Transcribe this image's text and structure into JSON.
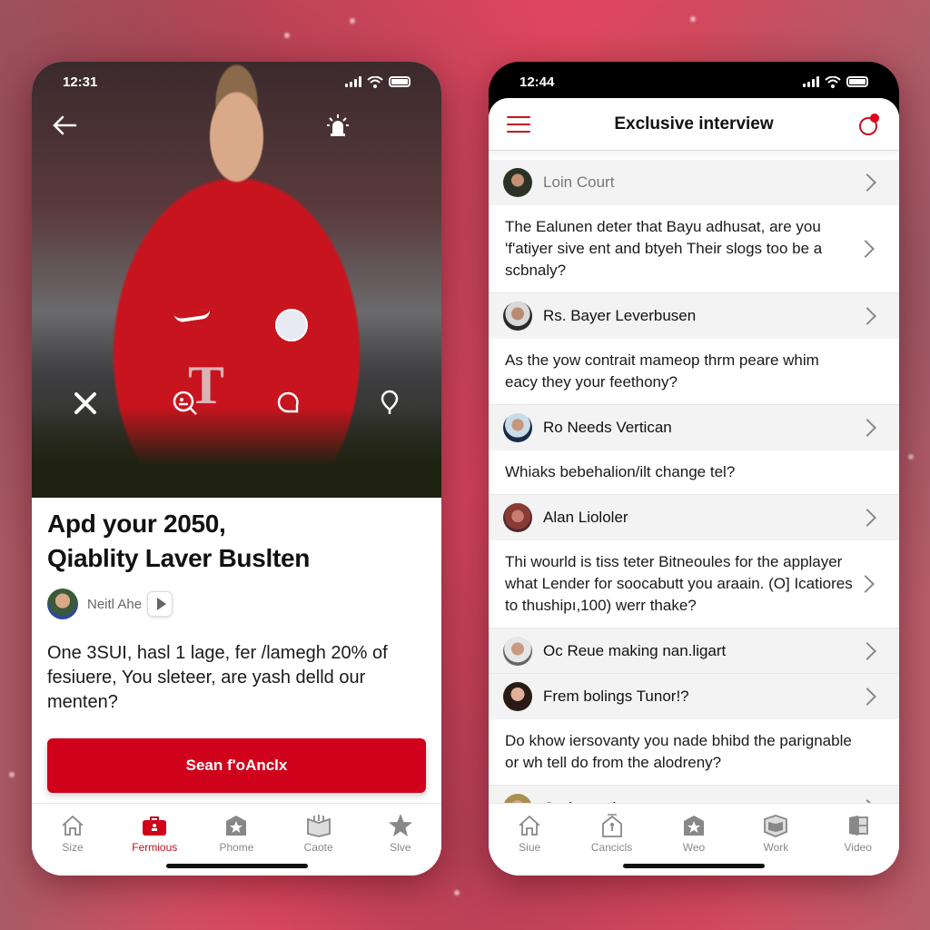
{
  "background": {
    "accent": "#e34660"
  },
  "left_phone": {
    "status": {
      "time": "12:31"
    },
    "hero": {
      "icons": [
        "back-arrow-icon",
        "alarm-icon",
        "close-icon",
        "search-person-icon",
        "chat-bubble-icon",
        "location-pin-icon"
      ],
      "jersey_mark": "T"
    },
    "headline_line1": "Apd your 2050,",
    "headline_line2": "Qiablity Laver Buslten",
    "author": {
      "name": "Neitl Ahe"
    },
    "body": "One 3SUI, hasl 1 lage, fer /lamegh 20% of fesiuere, You sleteer, are yash delld our menten?",
    "cta_label": "Sean f'oAnclx",
    "cta_color": "#d0021b",
    "tabs": [
      {
        "label": "Size",
        "icon": "home-icon",
        "active": false
      },
      {
        "label": "Fermious",
        "icon": "briefcase-icon",
        "active": true
      },
      {
        "label": "Phome",
        "icon": "star-badge-icon",
        "active": false
      },
      {
        "label": "Caote",
        "icon": "book-box-icon",
        "active": false
      },
      {
        "label": "Slve",
        "icon": "star-icon",
        "active": false
      }
    ]
  },
  "right_phone": {
    "status": {
      "time": "12:44"
    },
    "header": {
      "title": "Exclusive interview"
    },
    "items": [
      {
        "name": "Loin Court",
        "muted": true,
        "question": "The Ealunen deter that Bayu adhusat, are you 'f'atiyer sive ent and btyeh Their slogs too be a scbnaly?"
      },
      {
        "name": "Rs. Bayer Leverbusen",
        "muted": false,
        "question": "As the yow contrait mameop thrm  peare whim eacy they your feethony?"
      },
      {
        "name": "Ro Needs Vertican",
        "muted": false,
        "question": "Whiaks bebehalion/ilt change tel?"
      },
      {
        "name": "Alan Liololer",
        "muted": false,
        "question": "Thi wourld is tiss teter Bitneoules for the applayer what Lender for soocabutt you araain. (O] Icatiores to thushipı,100) werr thake?"
      },
      {
        "name": "Oc Reue making nan.ligart",
        "muted": false,
        "question": ""
      },
      {
        "name": "Frem bolings Tunor!?",
        "muted": false,
        "question": "Do khow iersovanty you nade bhibd the parignable or wh tell do from the alodreny?"
      },
      {
        "name": "Ouderarzd",
        "muted": false,
        "question": ""
      }
    ],
    "tabs": [
      {
        "label": "Siue",
        "icon": "home-icon"
      },
      {
        "label": "Cancicls",
        "icon": "house-lock-icon"
      },
      {
        "label": "Weo",
        "icon": "star-badge-icon"
      },
      {
        "label": "Work",
        "icon": "book-icon"
      },
      {
        "label": "Video",
        "icon": "video-box-icon"
      }
    ]
  }
}
